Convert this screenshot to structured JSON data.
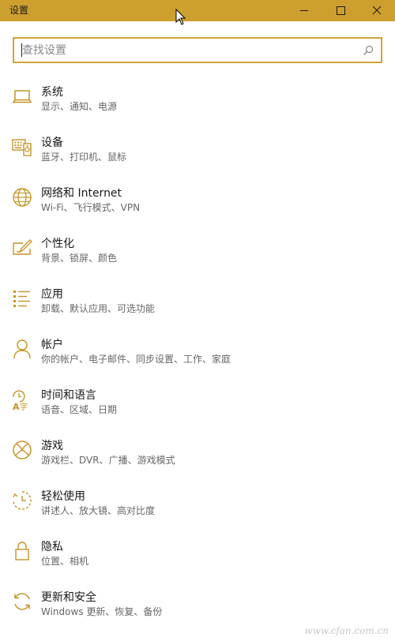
{
  "window": {
    "title": "设置",
    "accent_color": "#cd9f2f",
    "icon_color": "#c69324"
  },
  "titlebar_buttons": {
    "minimize_icon": "minimize-icon",
    "maximize_icon": "maximize-icon",
    "close_icon": "close-icon"
  },
  "search": {
    "placeholder": "查找设置",
    "value": "",
    "icon": "search-icon"
  },
  "categories": [
    {
      "id": "system",
      "name": "系统",
      "desc": "显示、通知、电源",
      "icon": "laptop-icon"
    },
    {
      "id": "devices",
      "name": "设备",
      "desc": "蓝牙、打印机、鼠标",
      "icon": "keyboard-device-icon"
    },
    {
      "id": "network",
      "name": "网络和 Internet",
      "desc": "Wi-Fi、飞行模式、VPN",
      "icon": "globe-icon"
    },
    {
      "id": "personalization",
      "name": "个性化",
      "desc": "背景、锁屏、颜色",
      "icon": "paint-brush-icon"
    },
    {
      "id": "apps",
      "name": "应用",
      "desc": "卸载、默认应用、可选功能",
      "icon": "apps-list-icon"
    },
    {
      "id": "accounts",
      "name": "帐户",
      "desc": "你的帐户、电子邮件、同步设置、工作、家庭",
      "icon": "person-icon"
    },
    {
      "id": "time-language",
      "name": "时间和语言",
      "desc": "语音、区域、日期",
      "icon": "time-language-icon"
    },
    {
      "id": "gaming",
      "name": "游戏",
      "desc": "游戏栏、DVR、广播、游戏模式",
      "icon": "xbox-icon"
    },
    {
      "id": "ease-of-access",
      "name": "轻松使用",
      "desc": "讲述人、放大镜、高对比度",
      "icon": "ease-of-access-icon"
    },
    {
      "id": "privacy",
      "name": "隐私",
      "desc": "位置、相机",
      "icon": "lock-icon"
    },
    {
      "id": "update-security",
      "name": "更新和安全",
      "desc": "Windows 更新、恢复、备份",
      "icon": "sync-icon"
    }
  ],
  "watermark": "www.cfan.com.cn"
}
